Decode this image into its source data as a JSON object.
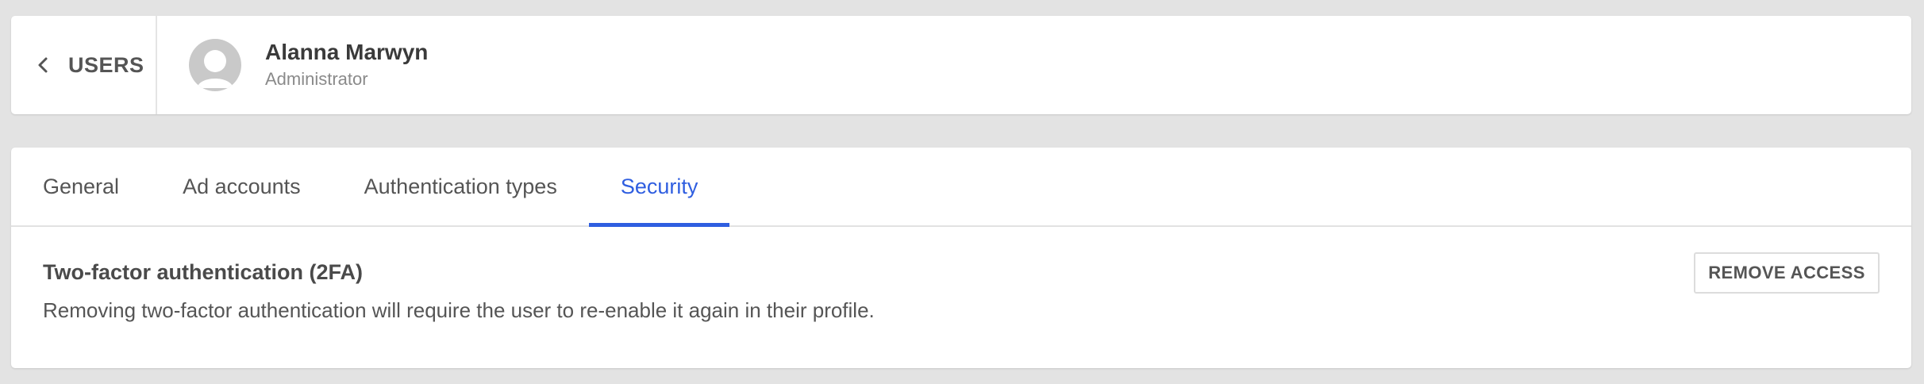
{
  "header": {
    "back_label": "USERS",
    "user": {
      "name": "Alanna Marwyn",
      "role": "Administrator"
    }
  },
  "tabs": [
    {
      "label": "General",
      "active": false
    },
    {
      "label": "Ad accounts",
      "active": false
    },
    {
      "label": "Authentication types",
      "active": false
    },
    {
      "label": "Security",
      "active": true
    }
  ],
  "security": {
    "title": "Two-factor authentication (2FA)",
    "description": "Removing two-factor authentication will require the user to re-enable it again in their profile.",
    "remove_button": "REMOVE ACCESS"
  },
  "colors": {
    "accent": "#2f5ee0",
    "background": "#e3e3e3",
    "card": "#ffffff"
  },
  "icons": {
    "back": "chevron-left-icon",
    "avatar": "user-placeholder-icon"
  }
}
